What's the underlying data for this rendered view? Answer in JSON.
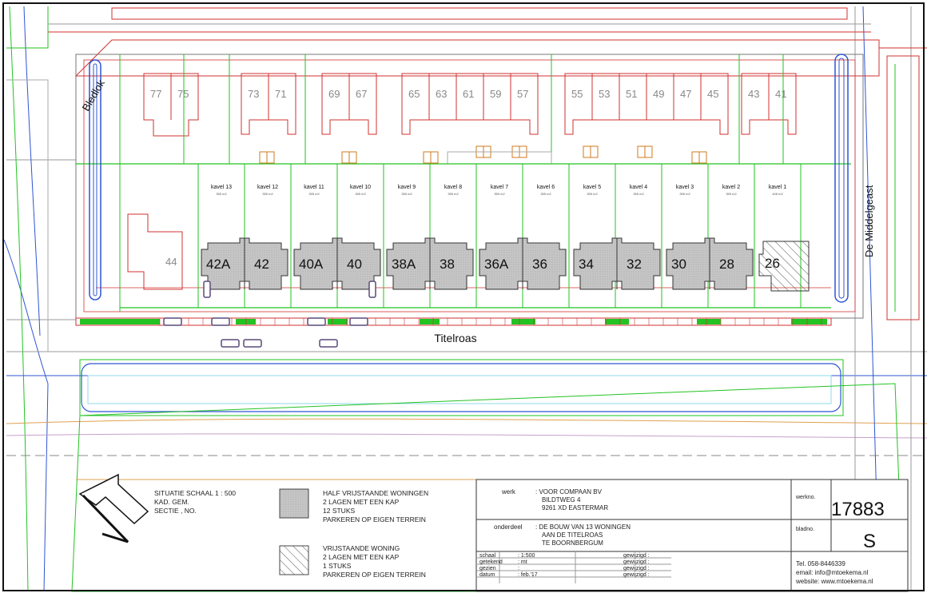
{
  "streets": {
    "bledlok": "Bledlok",
    "middelgeast": "De Middelgeast",
    "titelroas": "Titelroas"
  },
  "existing_house_numbers": [
    "77",
    "75",
    "73",
    "71",
    "69",
    "67",
    "65",
    "63",
    "61",
    "59",
    "57",
    "55",
    "53",
    "51",
    "49",
    "47",
    "45",
    "43",
    "41"
  ],
  "plots": [
    {
      "kavel": "kavel 13",
      "area": "355 m2"
    },
    {
      "kavel": "kavel 12",
      "area": "355 m2"
    },
    {
      "kavel": "kavel 11",
      "area": "355 m2"
    },
    {
      "kavel": "kavel 10",
      "area": "355 m2"
    },
    {
      "kavel": "kavel 9",
      "area": "355 m2"
    },
    {
      "kavel": "kavel 8",
      "area": "355 m2"
    },
    {
      "kavel": "kavel 7",
      "area": "355 m2"
    },
    {
      "kavel": "kavel 6",
      "area": "355 m2"
    },
    {
      "kavel": "kavel 5",
      "area": "355 m2"
    },
    {
      "kavel": "kavel 4",
      "area": "355 m2"
    },
    {
      "kavel": "kavel 3",
      "area": "355 m2"
    },
    {
      "kavel": "kavel 2",
      "area": "355 m2"
    },
    {
      "kavel": "kavel 1",
      "area": "408 m2"
    }
  ],
  "new_houses": [
    {
      "left": "42A",
      "right": "42"
    },
    {
      "left": "40A",
      "right": "40"
    },
    {
      "left": "38A",
      "right": "38"
    },
    {
      "left": "36A",
      "right": "36"
    },
    {
      "left": "34",
      "right": "32"
    },
    {
      "left": "30",
      "right": "28"
    }
  ],
  "detached_house": "26",
  "existing_44": "44",
  "legend": {
    "situatie": [
      "SITUATIE SCHAAL 1 : 500",
      "KAD. GEM.",
      "SECTIE  , NO."
    ],
    "half_vrijstaand": [
      "HALF VRIJSTAANDE WONINGEN",
      "2 LAGEN MET EEN KAP",
      "12 STUKS",
      "PARKEREN OP EIGEN TERREIN"
    ],
    "vrijstaand": [
      "VRIJSTAANDE WONING",
      "2 LAGEN MET EEN KAP",
      "1 STUKS",
      "PARKEREN OP EIGEN TERREIN"
    ]
  },
  "title_block": {
    "werk_label": "werk",
    "werk": [
      ": VOOR COMPAAN BV",
      "BILDTWEG 4",
      "9261 XD EASTERMAR"
    ],
    "onderdeel_label": "onderdeel",
    "onderdeel": [
      ": DE BOUW VAN 13 WONINGEN",
      "AAN DE TITELROAS",
      "TE BOORNBERGUM"
    ],
    "rows": [
      {
        "label": "schaal",
        "value": ": 1:500",
        "right": "gewijzigd :"
      },
      {
        "label": "getekend",
        "value": ": mt",
        "right": "gewijzigd :"
      },
      {
        "label": "gezien",
        "value": ":",
        "right": "gewijzigd :"
      },
      {
        "label": "datum",
        "value": ": feb.'17",
        "right": "gewijzigd :"
      }
    ],
    "werkno_label": "werkno.",
    "werkno": "17883",
    "blad_label": "bladno.",
    "blad": "S",
    "contact": [
      "Tel. 058-8446339",
      "email: info@mtoekema.nl",
      "website: www.mtoekema.nl"
    ]
  },
  "colors": {
    "existing": "#d23232",
    "plot_line": "#22c322",
    "house_fill": "#c8c8c8",
    "blue": "#2f55d4",
    "car": "#5a4a7a"
  }
}
